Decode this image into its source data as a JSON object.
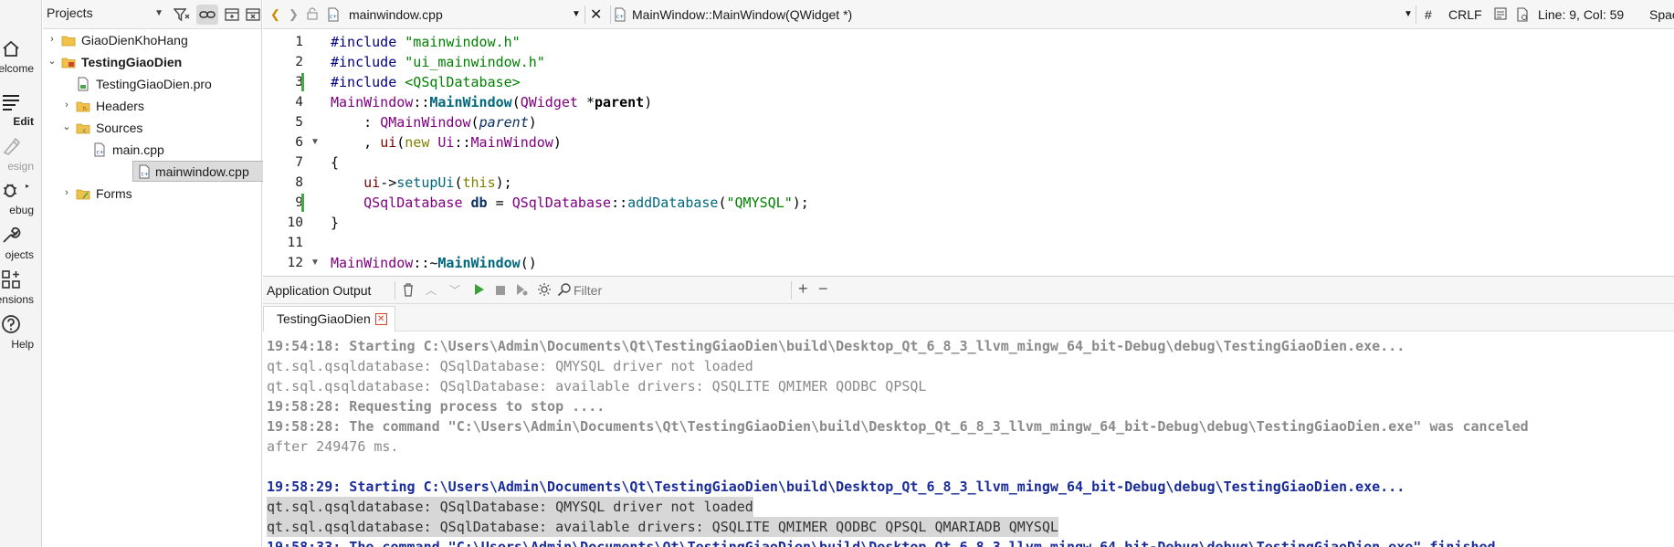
{
  "modebar": {
    "items": [
      {
        "label": "elcome",
        "icon": "home-icon"
      },
      {
        "label": "Edit",
        "icon": "edit-icon"
      },
      {
        "label": "esign",
        "icon": "design-icon"
      },
      {
        "label": "ebug",
        "icon": "debug-icon"
      },
      {
        "label": "ojects",
        "icon": "projects-icon"
      },
      {
        "label": "ensions",
        "icon": "extensions-icon"
      },
      {
        "label": "Help",
        "icon": "help-icon"
      }
    ]
  },
  "sidebar": {
    "selector": "Projects",
    "tree": [
      {
        "label": "GiaoDienKhoHang"
      },
      {
        "label": "TestingGiaoDien"
      },
      {
        "label": "TestingGiaoDien.pro"
      },
      {
        "label": "Headers"
      },
      {
        "label": "Sources"
      },
      {
        "label": "main.cpp"
      },
      {
        "label": "mainwindow.cpp"
      },
      {
        "label": "Forms"
      }
    ]
  },
  "editor": {
    "file": "mainwindow.cpp",
    "symbol": "MainWindow::MainWindow(QWidget *)",
    "hash": "#",
    "line_ending": "CRLF",
    "cursor": "Line: 9, Col: 59",
    "indent": "Spac",
    "line_numbers": [
      "1",
      "2",
      "3",
      "4",
      "5",
      "6",
      "7",
      "8",
      "9",
      "10",
      "11",
      "12"
    ]
  },
  "output": {
    "title": "Application Output",
    "filter_placeholder": "Filter",
    "plus": "+",
    "minus": "−",
    "tab": "TestingGiaoDien",
    "lines": [
      "19:54:18: Starting C:\\Users\\Admin\\Documents\\Qt\\TestingGiaoDien\\build\\Desktop_Qt_6_8_3_llvm_mingw_64_bit-Debug\\debug\\TestingGiaoDien.exe...",
      "qt.sql.qsqldatabase: QSqlDatabase: QMYSQL driver not loaded",
      "qt.sql.qsqldatabase: QSqlDatabase: available drivers: QSQLITE QMIMER QODBC QPSQL",
      "19:58:28: Requesting process to stop ....",
      "19:58:28: The command \"C:\\Users\\Admin\\Documents\\Qt\\TestingGiaoDien\\build\\Desktop_Qt_6_8_3_llvm_mingw_64_bit-Debug\\debug\\TestingGiaoDien.exe\" was canceled",
      "after 249476 ms.",
      "19:58:29: Starting C:\\Users\\Admin\\Documents\\Qt\\TestingGiaoDien\\build\\Desktop_Qt_6_8_3_llvm_mingw_64_bit-Debug\\debug\\TestingGiaoDien.exe...",
      "qt.sql.qsqldatabase: QSqlDatabase: QMYSQL driver not loaded",
      "qt.sql.qsqldatabase: QSqlDatabase: available drivers: QSQLITE QMIMER QODBC QPSQL QMARIADB QMYSQL",
      "19:58:33: The command \"C:\\Users\\Admin\\Documents\\Qt\\TestingGiaoDien\\build\\Desktop_Qt_6_8_3_llvm_mingw_64_bit-Debug\\debug\\TestingGiaoDien.exe\" finished"
    ]
  }
}
